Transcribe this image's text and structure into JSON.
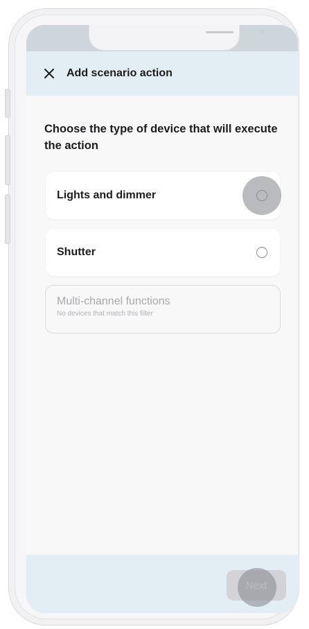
{
  "header": {
    "close_icon": "close-icon",
    "title": "Add scenario action"
  },
  "question": "Choose the type of device that will execute the action",
  "options": [
    {
      "label": "Lights and dimmer",
      "selected": false
    },
    {
      "label": "Shutter",
      "selected": false
    }
  ],
  "disabled_option": {
    "title": "Multi-channel functions",
    "subtitle": "No devices that match this filter"
  },
  "footer": {
    "next_label": "Next",
    "next_enabled": false
  },
  "colors": {
    "header_bg": "#e3eef4",
    "footer_bg": "#e3eef4",
    "screen_bg": "#f8f8f9",
    "disabled_button": "#d3d3d7"
  }
}
